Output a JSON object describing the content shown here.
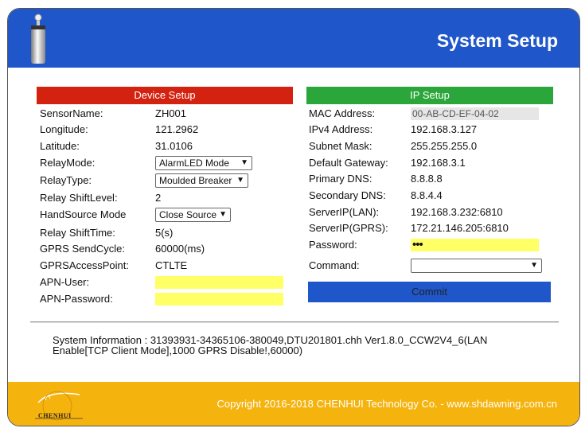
{
  "header": {
    "title": "System Setup"
  },
  "device_setup": {
    "heading": "Device Setup",
    "sensor_name": {
      "label": "SensorName:",
      "value": "ZH001"
    },
    "longitude": {
      "label": "Longitude:",
      "value": "121.2962"
    },
    "latitude": {
      "label": "Latitude:",
      "value": "31.0106"
    },
    "relay_mode": {
      "label": "RelayMode:",
      "value": "AlarmLED Mode"
    },
    "relay_type": {
      "label": "RelayType:",
      "value": "Moulded Breaker"
    },
    "relay_shift_level": {
      "label": "Relay ShiftLevel:",
      "value": "2"
    },
    "hand_source_mode": {
      "label": "HandSource Mode",
      "value": "Close Source"
    },
    "relay_shift_time": {
      "label": "Relay ShiftTime:",
      "value": "5(s)"
    },
    "gprs_send_cycle": {
      "label": "GPRS SendCycle:",
      "value": "60000(ms)"
    },
    "gprs_access_point": {
      "label": "GPRSAccessPoint:",
      "value": "CTLTE"
    },
    "apn_user": {
      "label": "APN-User:",
      "value": ""
    },
    "apn_password": {
      "label": "APN-Password:",
      "value": ""
    }
  },
  "ip_setup": {
    "heading": "IP Setup",
    "mac_address": {
      "label": "MAC Address:",
      "value": "00-AB-CD-EF-04-02"
    },
    "ipv4_address": {
      "label": "IPv4 Address:",
      "value": "192.168.3.127"
    },
    "subnet_mask": {
      "label": "Subnet Mask:",
      "value": "255.255.255.0"
    },
    "default_gateway": {
      "label": "Default Gateway:",
      "value": "192.168.3.1"
    },
    "primary_dns": {
      "label": "Primary DNS:",
      "value": "8.8.8.8"
    },
    "secondary_dns": {
      "label": "Secondary DNS:",
      "value": "8.8.4.4"
    },
    "server_ip_lan": {
      "label": "ServerIP(LAN):",
      "value": "192.168.3.232:6810"
    },
    "server_ip_gprs": {
      "label": "ServerIP(GPRS):",
      "value": "172.21.146.205:6810"
    },
    "password": {
      "label": "Password:",
      "value": "•••"
    },
    "command": {
      "label": "Command:",
      "value": ""
    },
    "commit_label": "Commit"
  },
  "system_info": {
    "line1": "System Information : 31393931-34365106-380049,DTU201801.chh Ver1.8.0_CCW2V4_6(LAN",
    "line2": "Enable[TCP Client Mode],1000 GPRS Disable!,60000)"
  },
  "footer": {
    "copyright": "Copyright 2016-2018 CHENHUI Technology Co. - www.shdawning.com.cn",
    "logo_text": "CHENHUI"
  },
  "colors": {
    "header_blue": "#1f56c9",
    "device_head_red": "#d32210",
    "ip_head_green": "#2ba63a",
    "footer_orange": "#f5b30e",
    "input_yellow": "#ffff66"
  }
}
